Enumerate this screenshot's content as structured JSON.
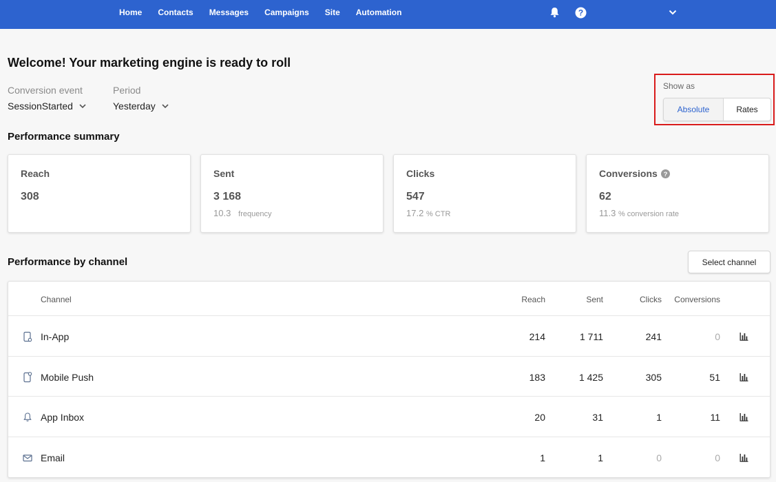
{
  "nav": {
    "items": [
      "Home",
      "Contacts",
      "Messages",
      "Campaigns",
      "Site",
      "Automation"
    ],
    "icons": [
      "bell-icon",
      "help-icon",
      "chevron-down-icon"
    ]
  },
  "welcome": {
    "title": "Welcome! Your marketing engine is ready to roll"
  },
  "filters": {
    "conversion_label": "Conversion event",
    "conversion_value": "SessionStarted",
    "period_label": "Period",
    "period_value": "Yesterday"
  },
  "show_as": {
    "label": "Show as",
    "options": [
      "Absolute",
      "Rates"
    ],
    "selected": "Absolute"
  },
  "summary": {
    "title": "Performance summary",
    "cards": [
      {
        "title": "Reach",
        "value": "308",
        "sub_value": "",
        "sub_unit": ""
      },
      {
        "title": "Sent",
        "value": "3 168",
        "sub_value": "10.3",
        "sub_unit": "frequency"
      },
      {
        "title": "Clicks",
        "value": "547",
        "sub_value": "17.2",
        "sub_unit": "% CTR"
      },
      {
        "title": "Conversions",
        "value": "62",
        "sub_value": "11.3",
        "sub_unit": "% conversion rate"
      }
    ]
  },
  "channels": {
    "title": "Performance by channel",
    "select_button": "Select channel",
    "columns": [
      "Channel",
      "Reach",
      "Sent",
      "Clicks",
      "Conversions"
    ],
    "rows": [
      {
        "icon": "in-app-icon",
        "channel": "In-App",
        "reach": "214",
        "sent": "1 711",
        "clicks": "241",
        "conversions": "0"
      },
      {
        "icon": "mobile-push-icon",
        "channel": "Mobile Push",
        "reach": "183",
        "sent": "1 425",
        "clicks": "305",
        "conversions": "51"
      },
      {
        "icon": "bell-icon",
        "channel": "App Inbox",
        "reach": "20",
        "sent": "31",
        "clicks": "1",
        "conversions": "11"
      },
      {
        "icon": "mail-icon",
        "channel": "Email",
        "reach": "1",
        "sent": "1",
        "clicks": "0",
        "conversions": "0"
      }
    ]
  },
  "colors": {
    "brand": "#2d63cf",
    "highlight": "#d91a1a"
  }
}
